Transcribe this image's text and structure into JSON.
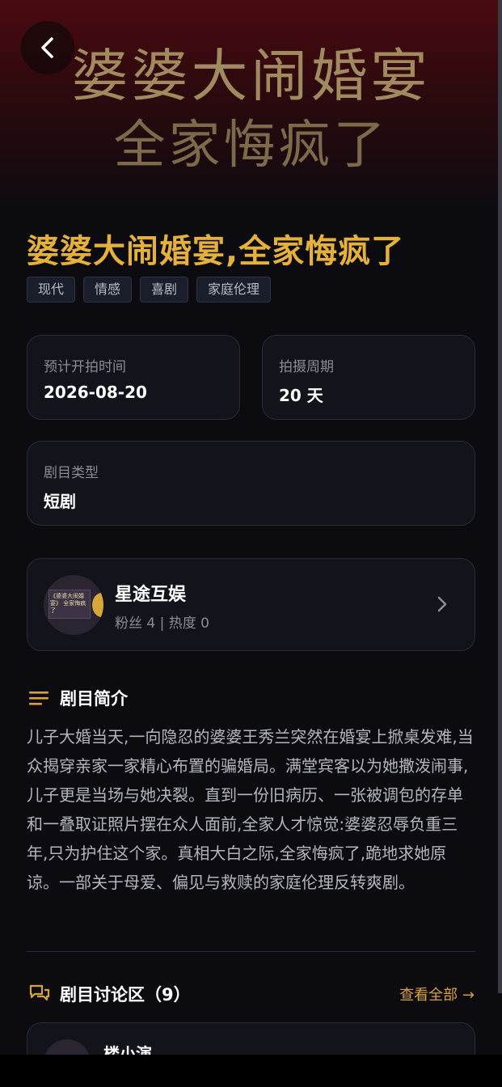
{
  "poster": {
    "line1": "婆婆大闹婚宴",
    "line2": "全家悔疯了"
  },
  "drama": {
    "title": "婆婆大闹婚宴,全家悔疯了",
    "tags": [
      "现代",
      "情感",
      "喜剧",
      "家庭伦理"
    ]
  },
  "info": {
    "start": {
      "label": "预计开拍时间",
      "value": "2026-08-20"
    },
    "period": {
      "label": "拍摄周期",
      "value": "20 天"
    },
    "type": {
      "label": "剧目类型",
      "value": "短剧"
    }
  },
  "studio": {
    "name": "星途互娱",
    "stats": "粉丝 4 | 热度 0",
    "avatar_text": "《婆婆大闹婚宴》 全家悔疯了"
  },
  "synopsis": {
    "heading": "剧目简介",
    "text": "儿子大婚当天,一向隐忍的婆婆王秀兰突然在婚宴上掀桌发难,当众揭穿亲家一家精心布置的骗婚局。满堂宾客以为她撒泼闹事,儿子更是当场与她决裂。直到一份旧病历、一张被调包的存单和一叠取证照片摆在众人面前,全家人才惊觉:婆婆忍辱负重三年,只为护住这个家。真相大白之际,全家悔疯了,跪地求她原谅。一部关于母爱、偏见与救赎的家庭伦理反转爽剧。"
  },
  "discussion": {
    "heading": "剧目讨论区（9）",
    "view_all": "查看全部 →",
    "first_comment_name": "楼小演"
  },
  "colors": {
    "accent": "#e5b13b",
    "background": "#0b0b10",
    "card": "#12131b"
  }
}
